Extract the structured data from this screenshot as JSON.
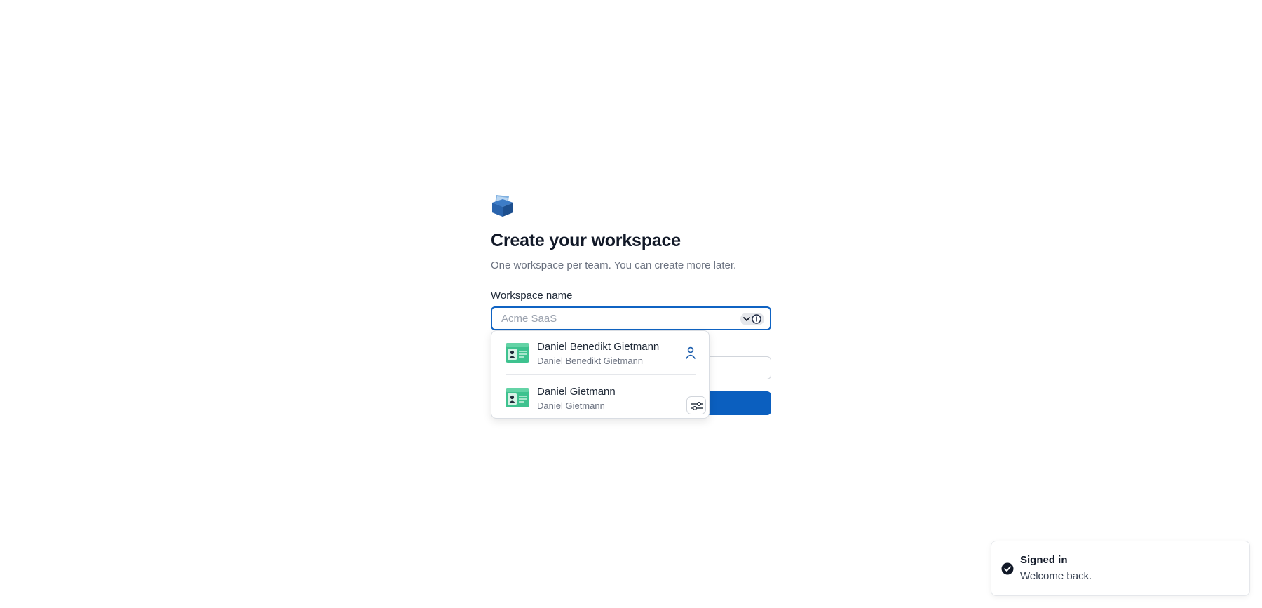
{
  "icons": {
    "logo": "workspace-logo-icon",
    "chevron": "chevron-down-icon",
    "info": "info-icon",
    "contact_card": "contact-card-icon",
    "person": "person-icon",
    "settings": "sliders-icon",
    "check": "check-circle-icon"
  },
  "colors": {
    "accent": "#0b5fbf",
    "focus_border": "#0f63c3",
    "card_green": "#3ec28f"
  },
  "page": {
    "title": "Create your workspace",
    "subtitle": "One workspace per team. You can create more later."
  },
  "form": {
    "workspace_name_label": "Workspace name",
    "workspace_name_placeholder": "Acme SaaS",
    "workspace_name_value": ""
  },
  "autofill": {
    "items": [
      {
        "name": "Daniel Benedikt Gietmann",
        "detail": "Daniel Benedikt Gietmann"
      },
      {
        "name": "Daniel Gietmann",
        "detail": "Daniel Gietmann"
      }
    ]
  },
  "toast": {
    "title": "Signed in",
    "message": "Welcome back."
  }
}
